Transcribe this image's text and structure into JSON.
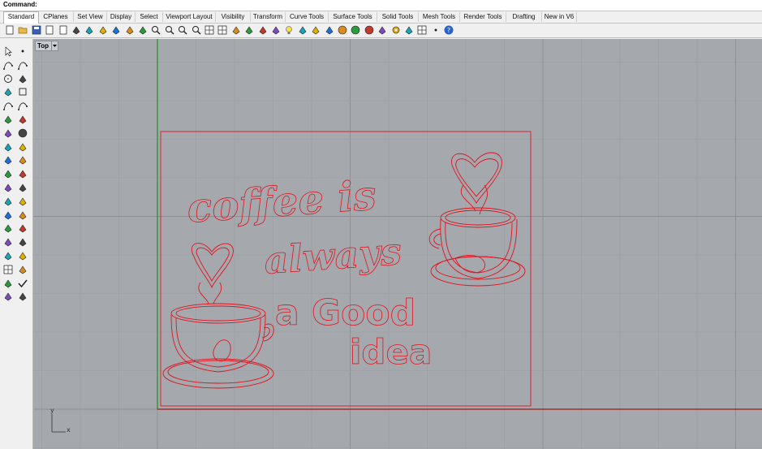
{
  "command": {
    "label": "Command:",
    "value": ""
  },
  "tabs": [
    {
      "label": "Standard",
      "active": true
    },
    {
      "label": "CPlanes"
    },
    {
      "label": "Set View"
    },
    {
      "label": "Display"
    },
    {
      "label": "Select"
    },
    {
      "label": "Viewport Layout"
    },
    {
      "label": "Visibility"
    },
    {
      "label": "Transform"
    },
    {
      "label": "Curve Tools"
    },
    {
      "label": "Surface Tools"
    },
    {
      "label": "Solid Tools"
    },
    {
      "label": "Mesh Tools"
    },
    {
      "label": "Render Tools"
    },
    {
      "label": "Drafting"
    },
    {
      "label": "New in V6"
    }
  ],
  "toolbar_icons": [
    "new-icon",
    "open-icon",
    "save-icon",
    "print-icon",
    "import-icon",
    "cut-icon",
    "copy-icon",
    "paste-icon",
    "undo-icon",
    "pan-icon",
    "rotate-view-icon",
    "zoom-icon",
    "zoom-extents-icon",
    "zoom-window-icon",
    "zoom-selected-icon",
    "four-viewports-icon",
    "viewport-layout-icon",
    "car-icon",
    "select-icon",
    "cplane-icon",
    "show-icon",
    "lightbulb-icon",
    "lock-icon",
    "layer-icon",
    "material-icon",
    "render-sphere-icon",
    "shaded-sphere-icon",
    "ghosted-sphere-icon",
    "render-icon",
    "options-gear-icon",
    "filter-icon",
    "grid-snap-icon",
    "points-icon",
    "help-icon"
  ],
  "sidebar_icons": [
    "select-arrow-icon",
    "point-icon",
    "polyline-icon",
    "curve-icon",
    "circle-icon",
    "ellipse-icon",
    "polygon-icon",
    "rectangle-icon",
    "arc-icon",
    "fillet-curve-icon",
    "surface-icon",
    "surface-edit-icon",
    "box-icon",
    "sphere-icon",
    "cylinder-icon",
    "extrude-icon",
    "boolean-icon",
    "shell-icon",
    "mesh-icon",
    "mesh-tool-icon",
    "split-icon",
    "join-icon",
    "trim-icon",
    "explode-icon",
    "offset-icon",
    "blend-icon",
    "array-icon",
    "move-icon",
    "group-icon",
    "block-icon",
    "solid-tools-icon",
    "dimension-icon",
    "grid-array-icon",
    "render-icon",
    "transform-icon",
    "check-icon",
    "analyze-icon",
    "draft-icon"
  ],
  "viewport": {
    "title": "Top",
    "axis_x": "x",
    "axis_y": "y"
  },
  "artwork": {
    "line1": "coffee is",
    "line2": "always",
    "line3": "a Good",
    "line4": "idea",
    "stroke_color": "#e0141e"
  },
  "colors": {
    "viewport_bg": "#a5a8ad",
    "grid_minor": "#9a9da2",
    "grid_major": "#8b8e93",
    "x_axis": "#9b1a1a",
    "y_axis": "#1f8f1f"
  }
}
